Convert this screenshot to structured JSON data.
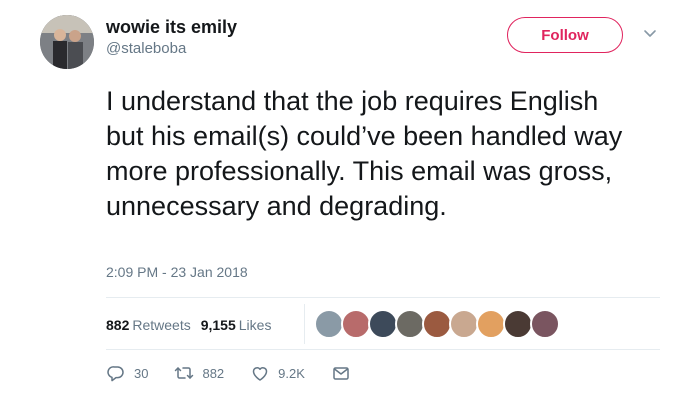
{
  "user": {
    "display_name": "wowie its emily",
    "handle": "@staleboba",
    "avatar_icon": "profile-photo"
  },
  "follow_button": {
    "label": "Follow",
    "color": "#e0245e"
  },
  "menu_icon": "chevron-down-icon",
  "tweet": {
    "text": "I understand that the job requires English but his email(s) could’ve been handled way more professionally. This email was gross, unnecessary and degrading.",
    "timestamp": "2:09 PM - 23 Jan 2018"
  },
  "stats": {
    "retweets_count": "882",
    "retweets_label": "Retweets",
    "likes_count": "9,155",
    "likes_label": "Likes"
  },
  "likers": [
    {
      "color": "#8a9aa6"
    },
    {
      "color": "#b86b6b"
    },
    {
      "color": "#3d4a5a"
    },
    {
      "color": "#6c6a63"
    },
    {
      "color": "#9b5a40"
    },
    {
      "color": "#c9a890"
    },
    {
      "color": "#e2a060"
    },
    {
      "color": "#4a3a34"
    },
    {
      "color": "#7a5560"
    }
  ],
  "actions": {
    "reply": {
      "icon": "reply-icon",
      "count": "30"
    },
    "retweet": {
      "icon": "retweet-icon",
      "count": "882"
    },
    "like": {
      "icon": "heart-icon",
      "count": "9.2K"
    },
    "message": {
      "icon": "envelope-icon"
    }
  }
}
